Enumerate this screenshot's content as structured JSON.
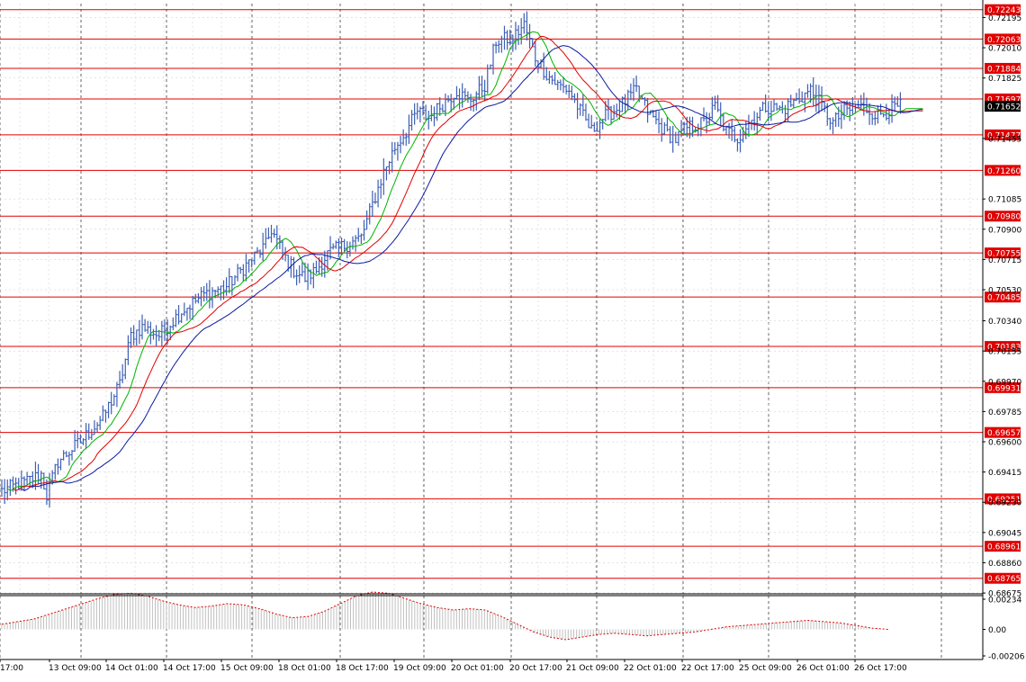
{
  "chart_data": {
    "type": "line",
    "style": "ohlc-bars",
    "background": "#ffffff",
    "colors": {
      "bars": "#3d5fb5",
      "ma_fast": "#00b400",
      "ma_mid": "#e00000",
      "ma_slow": "#0a1aa0",
      "level": "#e00000",
      "grid": "#c8c8c8",
      "axis_text": "#000000",
      "current_price_bg": "#000000",
      "osc_line": "#e00000",
      "osc_hist": "#c0c0c0"
    },
    "grid": true,
    "ylim": [
      0.6867,
      0.7228
    ],
    "price_ticks": [
      "0.72195",
      "0.72010",
      "0.71825",
      "0.71455",
      "0.71085",
      "0.70900",
      "0.70715",
      "0.70530",
      "0.70340",
      "0.70155",
      "0.69970",
      "0.69785",
      "0.69600",
      "0.69415",
      "0.69230",
      "0.69045",
      "0.68860",
      "0.68675"
    ],
    "price_tick_values": [
      0.72195,
      0.7201,
      0.71825,
      0.71455,
      0.71085,
      0.709,
      0.70715,
      0.7053,
      0.7034,
      0.70155,
      0.6997,
      0.69785,
      0.696,
      0.69415,
      0.6923,
      0.69045,
      0.6886,
      0.68675
    ],
    "levels": [
      "0.72243",
      "0.72063",
      "0.71884",
      "0.71697",
      "0.71477",
      "0.71260",
      "0.70980",
      "0.70755",
      "0.70485",
      "0.70183",
      "0.69931",
      "0.69657",
      "0.69251",
      "0.68961",
      "0.68765"
    ],
    "current_price": "0.71652",
    "x_labels": [
      "17:00",
      "13 Oct 09:00",
      "14 Oct 01:00",
      "14 Oct 17:00",
      "15 Oct 09:00",
      "18 Oct 01:00",
      "18 Oct 17:00",
      "19 Oct 09:00",
      "20 Oct 01:00",
      "20 Oct 17:00",
      "21 Oct 09:00",
      "22 Oct 01:00",
      "22 Oct 17:00",
      "25 Oct 09:00",
      "26 Oct 01:00",
      "26 Oct 17:00"
    ],
    "close_anchors": [
      [
        0,
        0.693
      ],
      [
        8,
        0.6935
      ],
      [
        14,
        0.694
      ],
      [
        16,
        0.6927
      ],
      [
        20,
        0.6948
      ],
      [
        28,
        0.696
      ],
      [
        36,
        0.6975
      ],
      [
        42,
        0.6995
      ],
      [
        46,
        0.7025
      ],
      [
        50,
        0.703
      ],
      [
        56,
        0.7025
      ],
      [
        64,
        0.704
      ],
      [
        72,
        0.705
      ],
      [
        80,
        0.7055
      ],
      [
        88,
        0.707
      ],
      [
        94,
        0.708
      ],
      [
        96,
        0.709
      ],
      [
        100,
        0.7075
      ],
      [
        104,
        0.7065
      ],
      [
        108,
        0.706
      ],
      [
        112,
        0.7065
      ],
      [
        116,
        0.7075
      ],
      [
        122,
        0.708
      ],
      [
        128,
        0.7085
      ],
      [
        132,
        0.7105
      ],
      [
        136,
        0.7125
      ],
      [
        140,
        0.714
      ],
      [
        144,
        0.715
      ],
      [
        148,
        0.7162
      ],
      [
        152,
        0.7158
      ],
      [
        156,
        0.7165
      ],
      [
        162,
        0.7175
      ],
      [
        166,
        0.7168
      ],
      [
        172,
        0.7178
      ],
      [
        176,
        0.7205
      ],
      [
        182,
        0.7207
      ],
      [
        186,
        0.7215
      ],
      [
        190,
        0.7195
      ],
      [
        194,
        0.7185
      ],
      [
        198,
        0.7178
      ],
      [
        202,
        0.7175
      ],
      [
        206,
        0.7162
      ],
      [
        210,
        0.715
      ],
      [
        214,
        0.7158
      ],
      [
        220,
        0.7165
      ],
      [
        226,
        0.7175
      ],
      [
        230,
        0.7162
      ],
      [
        236,
        0.715
      ],
      [
        240,
        0.7145
      ],
      [
        244,
        0.7152
      ],
      [
        250,
        0.7155
      ],
      [
        254,
        0.7165
      ],
      [
        258,
        0.715
      ],
      [
        262,
        0.7146
      ],
      [
        266,
        0.7155
      ],
      [
        272,
        0.7165
      ],
      [
        278,
        0.7163
      ],
      [
        284,
        0.717
      ],
      [
        288,
        0.7175
      ],
      [
        292,
        0.7165
      ],
      [
        296,
        0.7155
      ],
      [
        300,
        0.7162
      ],
      [
        306,
        0.7165
      ],
      [
        312,
        0.716
      ],
      [
        316,
        0.7163
      ],
      [
        320,
        0.7165
      ]
    ],
    "osc_ticks": [
      "0.00234",
      "0.00",
      "-0.00206"
    ],
    "osc_values": [
      0.0004,
      0.0006,
      0.0008,
      0.0012,
      0.0016,
      0.002,
      0.0024,
      0.0027,
      0.0028,
      0.0026,
      0.0022,
      0.0019,
      0.0017,
      0.0018,
      0.002,
      0.0019,
      0.0016,
      0.0012,
      0.0009,
      0.001,
      0.0014,
      0.002,
      0.0026,
      0.0029,
      0.0028,
      0.0024,
      0.002,
      0.0017,
      0.0015,
      0.0016,
      0.0015,
      0.001,
      0.0004,
      -0.0002,
      -0.0006,
      -0.0008,
      -0.0006,
      -0.0004,
      -0.0003,
      -0.0004,
      -0.0005,
      -0.0004,
      -0.0003,
      -0.0002,
      0.0,
      0.0002,
      0.0003,
      0.0004,
      0.0005,
      0.0006,
      0.0007,
      0.0006,
      0.0005,
      0.0003,
      0.0001,
      0.0
    ]
  }
}
